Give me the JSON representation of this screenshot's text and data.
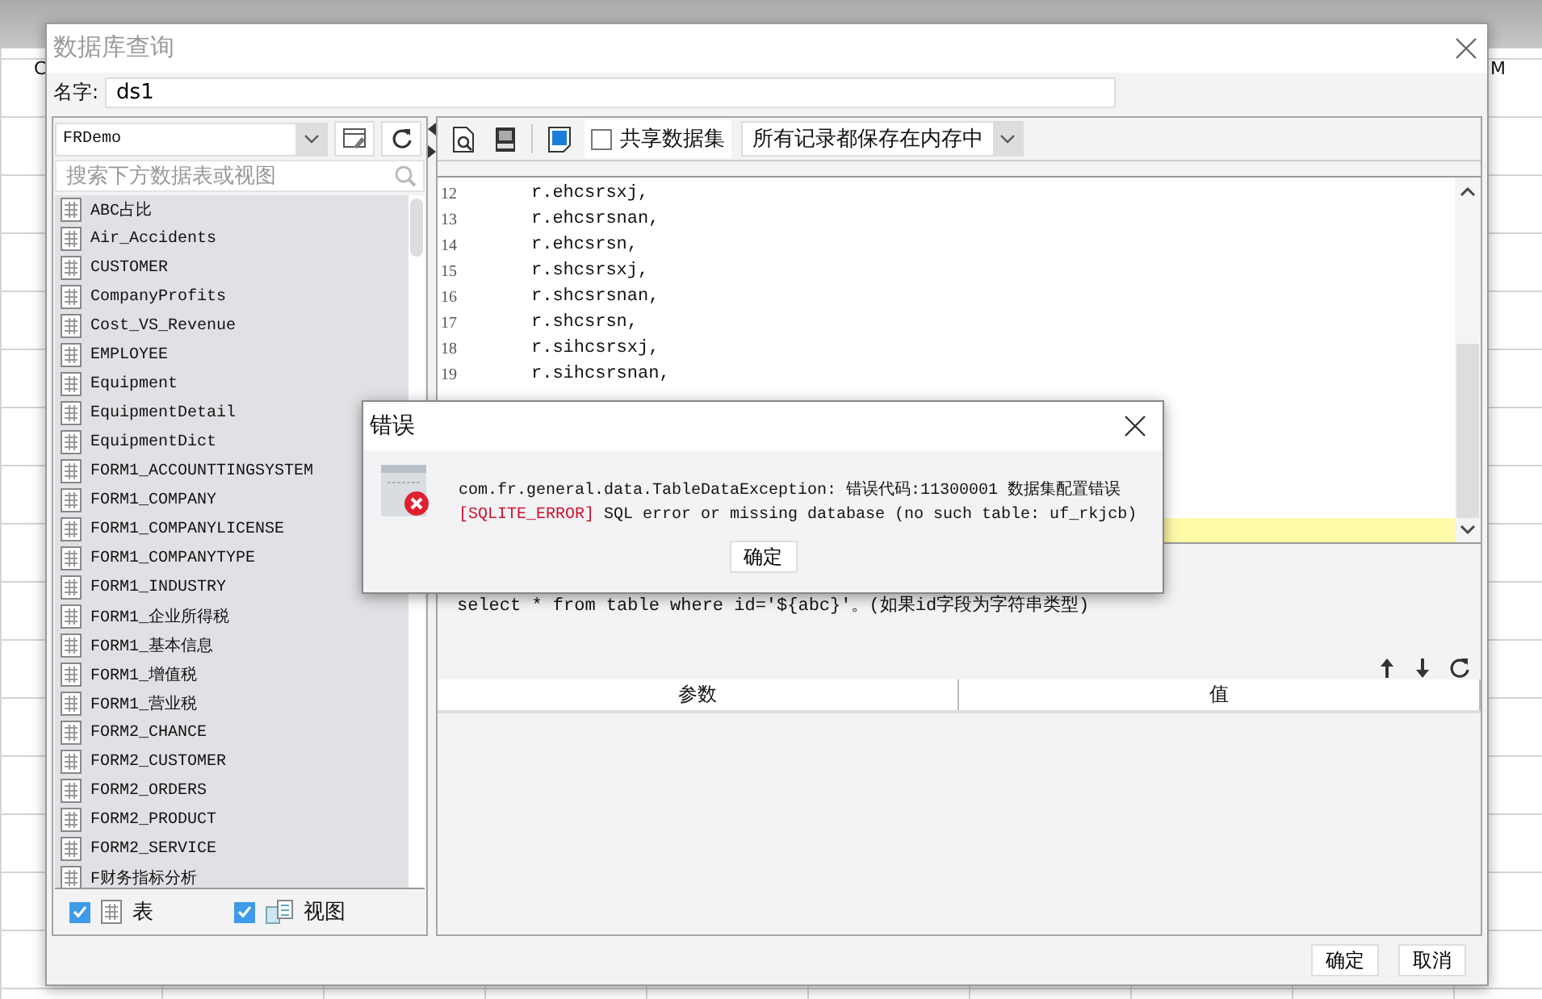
{
  "background": {
    "column_headers": [
      "C",
      "M"
    ]
  },
  "window": {
    "title": "数据库查询"
  },
  "name_field": {
    "label": "名字:",
    "value": "ds1"
  },
  "connection": {
    "value": "FRDemo"
  },
  "search": {
    "placeholder": "搜索下方数据表或视图"
  },
  "tables": [
    "ABC占比",
    "Air_Accidents",
    "CUSTOMER",
    "CompanyProfits",
    "Cost_VS_Revenue",
    "EMPLOYEE",
    "Equipment",
    "EquipmentDetail",
    "EquipmentDict",
    "FORM1_ACCOUNTTINGSYSTEM",
    "FORM1_COMPANY",
    "FORM1_COMPANYLICENSE",
    "FORM1_COMPANYTYPE",
    "FORM1_INDUSTRY",
    "FORM1_企业所得税",
    "FORM1_基本信息",
    "FORM1_增值税",
    "FORM1_营业税",
    "FORM2_CHANCE",
    "FORM2_CUSTOMER",
    "FORM2_ORDERS",
    "FORM2_PRODUCT",
    "FORM2_SERVICE",
    "F财务指标分析"
  ],
  "filters": [
    {
      "kind": "table",
      "label": "表",
      "checked": true
    },
    {
      "kind": "view",
      "label": "视图",
      "checked": true
    }
  ],
  "toolbar": {
    "share": {
      "label": "共享数据集",
      "checked": false
    },
    "storage": {
      "value": "所有记录都保存在内存中"
    }
  },
  "editor": {
    "lines": [
      {
        "number": "12",
        "code": "r.ehcsrsxj,"
      },
      {
        "number": "13",
        "code": "r.ehcsrsnan,"
      },
      {
        "number": "14",
        "code": "r.ehcsrsn,"
      },
      {
        "number": "15",
        "code": "r.shcsrsxj,"
      },
      {
        "number": "16",
        "code": "r.shcsrsnan,"
      },
      {
        "number": "17",
        "code": "r.shcsrsn,"
      },
      {
        "number": "18",
        "code": "r.sihcsrsxj,"
      },
      {
        "number": "19",
        "code": "r.sihcsrsnan,"
      }
    ]
  },
  "hint": {
    "lines": [
      "select * from table where id='${abc}'。(如果id字段为字符串类型)"
    ]
  },
  "params_table": {
    "columns": [
      "参数",
      "值"
    ]
  },
  "buttons": [
    "确定",
    "取消"
  ],
  "error_dialog": {
    "title": "错误",
    "message": "com.fr.general.data.TableDataException: 错误代码:11300001 数据集配置错误",
    "error_tag": "[SQLITE_ERROR]",
    "detail": " SQL error or missing database (no such table: uf_rkjcb)",
    "button": "确定"
  }
}
